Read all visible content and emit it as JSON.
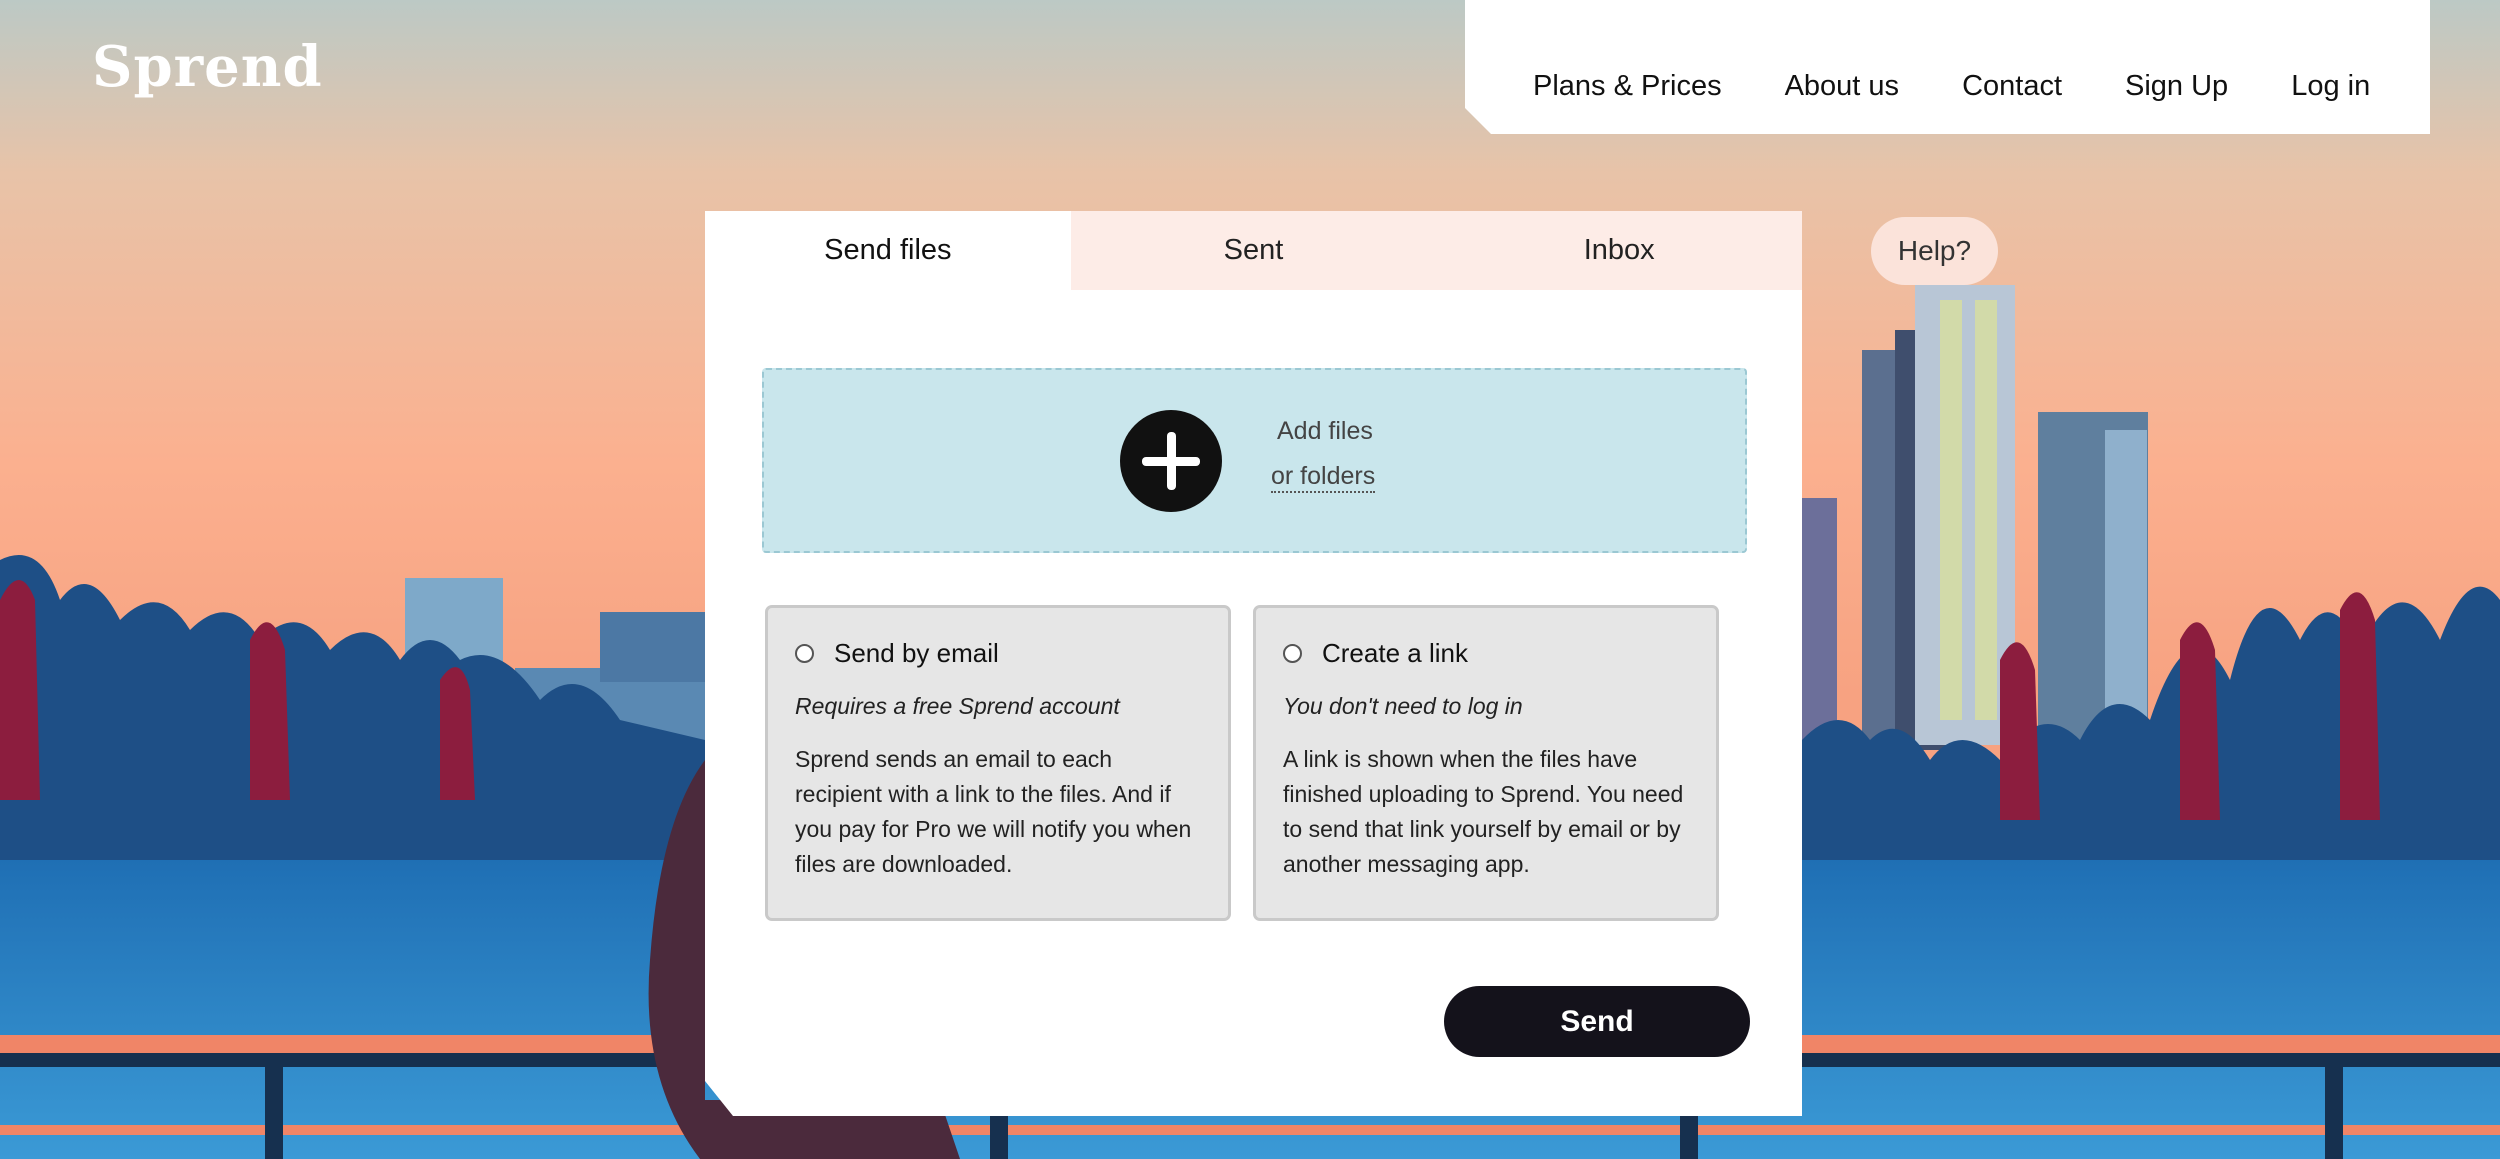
{
  "brand": {
    "logo_text": "Sprend"
  },
  "nav": {
    "items": [
      {
        "label": "Plans & Prices"
      },
      {
        "label": "About us"
      },
      {
        "label": "Contact"
      },
      {
        "label": "Sign Up"
      },
      {
        "label": "Log in"
      }
    ]
  },
  "tabs": [
    {
      "label": "Send files",
      "active": true
    },
    {
      "label": "Sent",
      "active": false
    },
    {
      "label": "Inbox",
      "active": false
    }
  ],
  "help": {
    "label": "Help?"
  },
  "dropzone": {
    "icon": "plus-circle-icon",
    "add_files": "Add files",
    "or_folders": "or folders"
  },
  "options": {
    "email": {
      "title": "Send by email",
      "note": "Requires a free Sprend account",
      "body": "Sprend sends an email to each recipient with a link to the files. And if you pay for Pro we will notify you when files are downloaded.",
      "selected": false
    },
    "link": {
      "title": "Create a link",
      "note": "You don't need to log in",
      "body": "A link is shown when the files have finished uploading to Sprend. You need to send that link yourself by email or by another messaging app.",
      "selected": false
    }
  },
  "send": {
    "label": "Send"
  },
  "colors": {
    "sky_top": "#bcc9c5",
    "sky_bottom": "#f9a98a",
    "water": "#2d82c4",
    "dropzone": "#c9e6ec",
    "tab_inactive": "#fdece7",
    "button_dark": "#14121b"
  }
}
